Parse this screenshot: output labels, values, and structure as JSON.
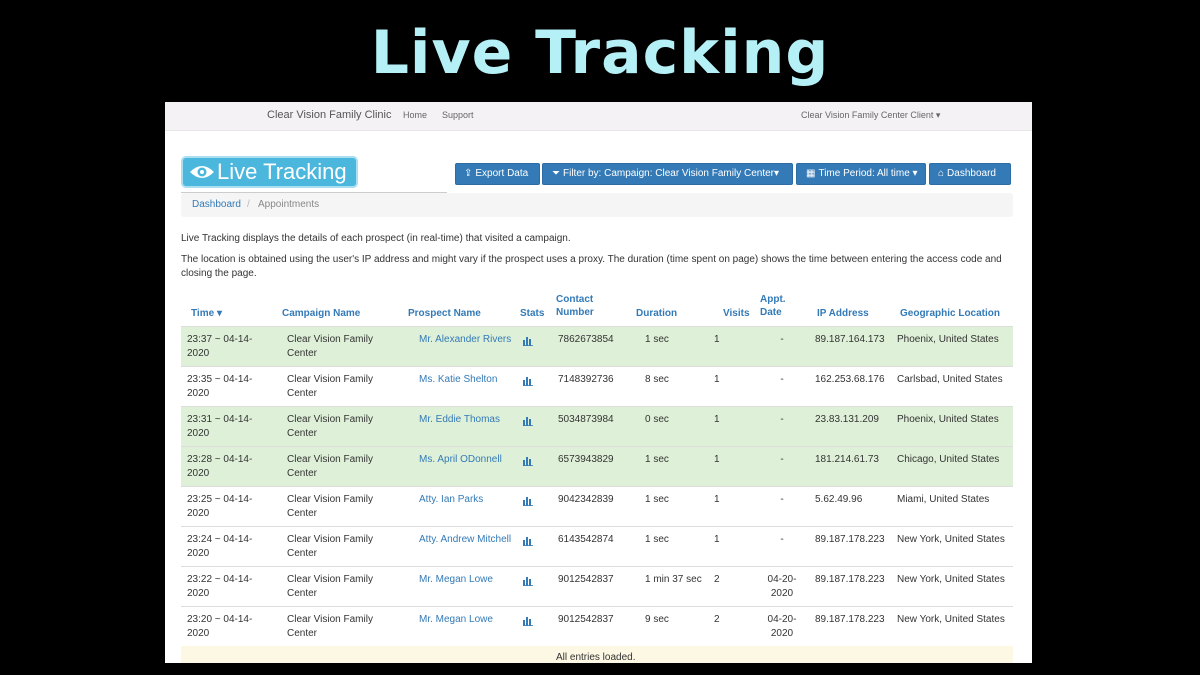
{
  "slide": {
    "title": "Live Tracking"
  },
  "navbar": {
    "brand": "Clear Vision Family Clinic",
    "home": "Home",
    "support": "Support",
    "user": "Clear Vision Family Center Client ▾"
  },
  "page": {
    "badge": "Live Tracking",
    "buttons": {
      "export": "Export Data",
      "filter": "Filter by: Campaign: Clear Vision Family Center▾",
      "period": "Time Period: All time ▾",
      "dashboard": "Dashboard"
    },
    "breadcrumb": {
      "link": "Dashboard",
      "sep": "/",
      "current": "Appointments"
    },
    "description1": "Live Tracking displays the details of each prospect (in real-time) that visited a campaign.",
    "description2": "The location is obtained using the user's IP address and might vary if the prospect uses a proxy. The duration (time spent on page) shows the time between entering the access code and closing the page."
  },
  "table": {
    "headers": {
      "time": "Time ▾",
      "campaign": "Campaign Name",
      "prospect": "Prospect Name",
      "stats": "Stats",
      "contact": "Contact Number",
      "duration": "Duration",
      "visits": "Visits",
      "appt": "Appt. Date",
      "ip": "IP Address",
      "geo": "Geographic Location"
    },
    "rows": [
      {
        "time": "23:37 ~ 04-14-2020",
        "campaign": "Clear Vision Family Center",
        "prospect": "Mr. Alexander Rivers",
        "contact": "7862673854",
        "duration": "1 sec",
        "visits": "1",
        "appt": "-",
        "ip": "89.187.164.173",
        "geo": "Phoenix, United States",
        "highlight": true
      },
      {
        "time": "23:35 ~ 04-14-2020",
        "campaign": "Clear Vision Family Center",
        "prospect": "Ms. Katie Shelton",
        "contact": "7148392736",
        "duration": "8 sec",
        "visits": "1",
        "appt": "-",
        "ip": "162.253.68.176",
        "geo": "Carlsbad, United States",
        "highlight": false
      },
      {
        "time": "23:31 ~ 04-14-2020",
        "campaign": "Clear Vision Family Center",
        "prospect": "Mr. Eddie Thomas",
        "contact": "5034873984",
        "duration": "0 sec",
        "visits": "1",
        "appt": "-",
        "ip": "23.83.131.209",
        "geo": "Phoenix, United States",
        "highlight": true
      },
      {
        "time": "23:28 ~ 04-14-2020",
        "campaign": "Clear Vision Family Center",
        "prospect": "Ms. April ODonnell",
        "contact": "6573943829",
        "duration": "1 sec",
        "visits": "1",
        "appt": "-",
        "ip": "181.214.61.73",
        "geo": "Chicago, United States",
        "highlight": true
      },
      {
        "time": "23:25 ~ 04-14-2020",
        "campaign": "Clear Vision Family Center",
        "prospect": "Atty. Ian Parks",
        "contact": "9042342839",
        "duration": "1 sec",
        "visits": "1",
        "appt": "-",
        "ip": "5.62.49.96",
        "geo": "Miami, United States",
        "highlight": false
      },
      {
        "time": "23:24 ~ 04-14-2020",
        "campaign": "Clear Vision Family Center",
        "prospect": "Atty. Andrew Mitchell",
        "contact": "6143542874",
        "duration": "1 sec",
        "visits": "1",
        "appt": "-",
        "ip": "89.187.178.223",
        "geo": "New York, United States",
        "highlight": false
      },
      {
        "time": "23:22 ~ 04-14-2020",
        "campaign": "Clear Vision Family Center",
        "prospect": "Mr. Megan Lowe",
        "contact": "9012542837",
        "duration": "1 min 37 sec",
        "visits": "2",
        "appt": "04-20-2020",
        "ip": "89.187.178.223",
        "geo": "New York, United States",
        "highlight": false
      },
      {
        "time": "23:20 ~ 04-14-2020",
        "campaign": "Clear Vision Family Center",
        "prospect": "Mr. Megan Lowe",
        "contact": "9012542837",
        "duration": "9 sec",
        "visits": "2",
        "appt": "04-20-2020",
        "ip": "89.187.178.223",
        "geo": "New York, United States",
        "highlight": false
      }
    ],
    "footer": "All entries loaded."
  },
  "colors": {
    "accent": "#337ab7",
    "highlight_row": "#dff0d8",
    "badge": "#4bb7dd",
    "title": "#b6f0f7"
  }
}
